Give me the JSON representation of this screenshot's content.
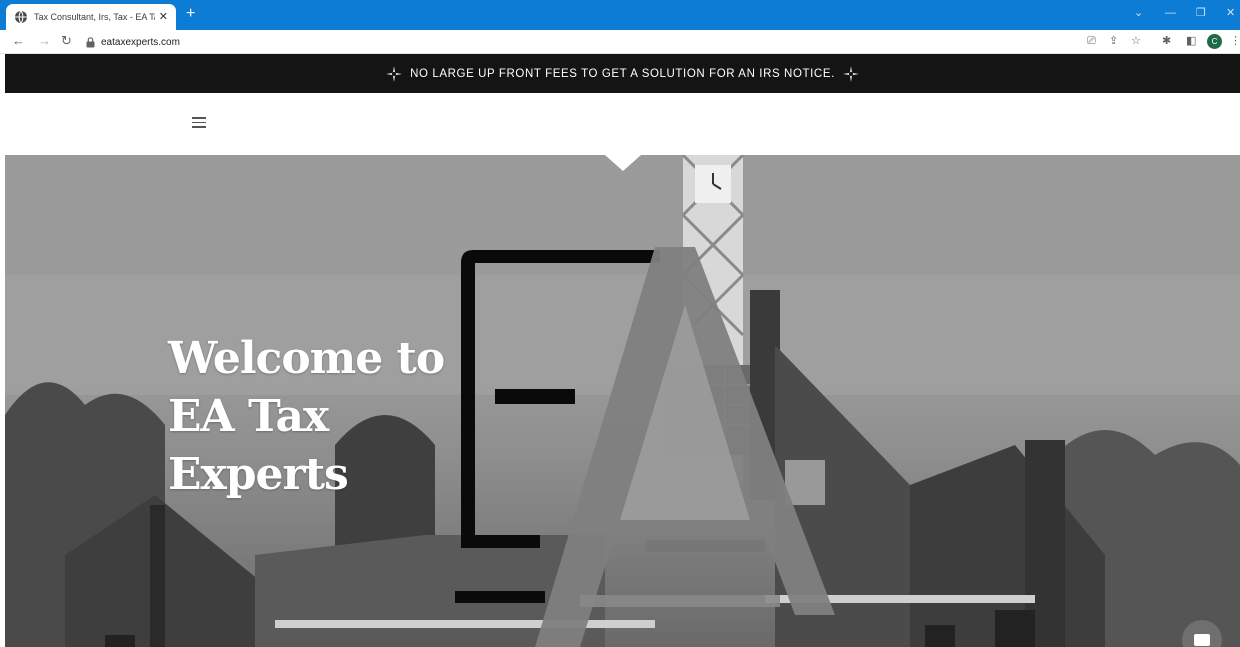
{
  "browser": {
    "tab_title": "Tax Consultant, Irs, Tax - EA Tax E",
    "url": "eataxexperts.com",
    "profile_initial": "C",
    "accent": "#0c7cd5"
  },
  "promo": {
    "text": "NO LARGE UP FRONT FEES TO GET A SOLUTION FOR AN IRS NOTICE."
  },
  "hero": {
    "headline_line1": "Welcome to",
    "headline_line2": "EA Tax",
    "headline_line3": "Experts"
  }
}
